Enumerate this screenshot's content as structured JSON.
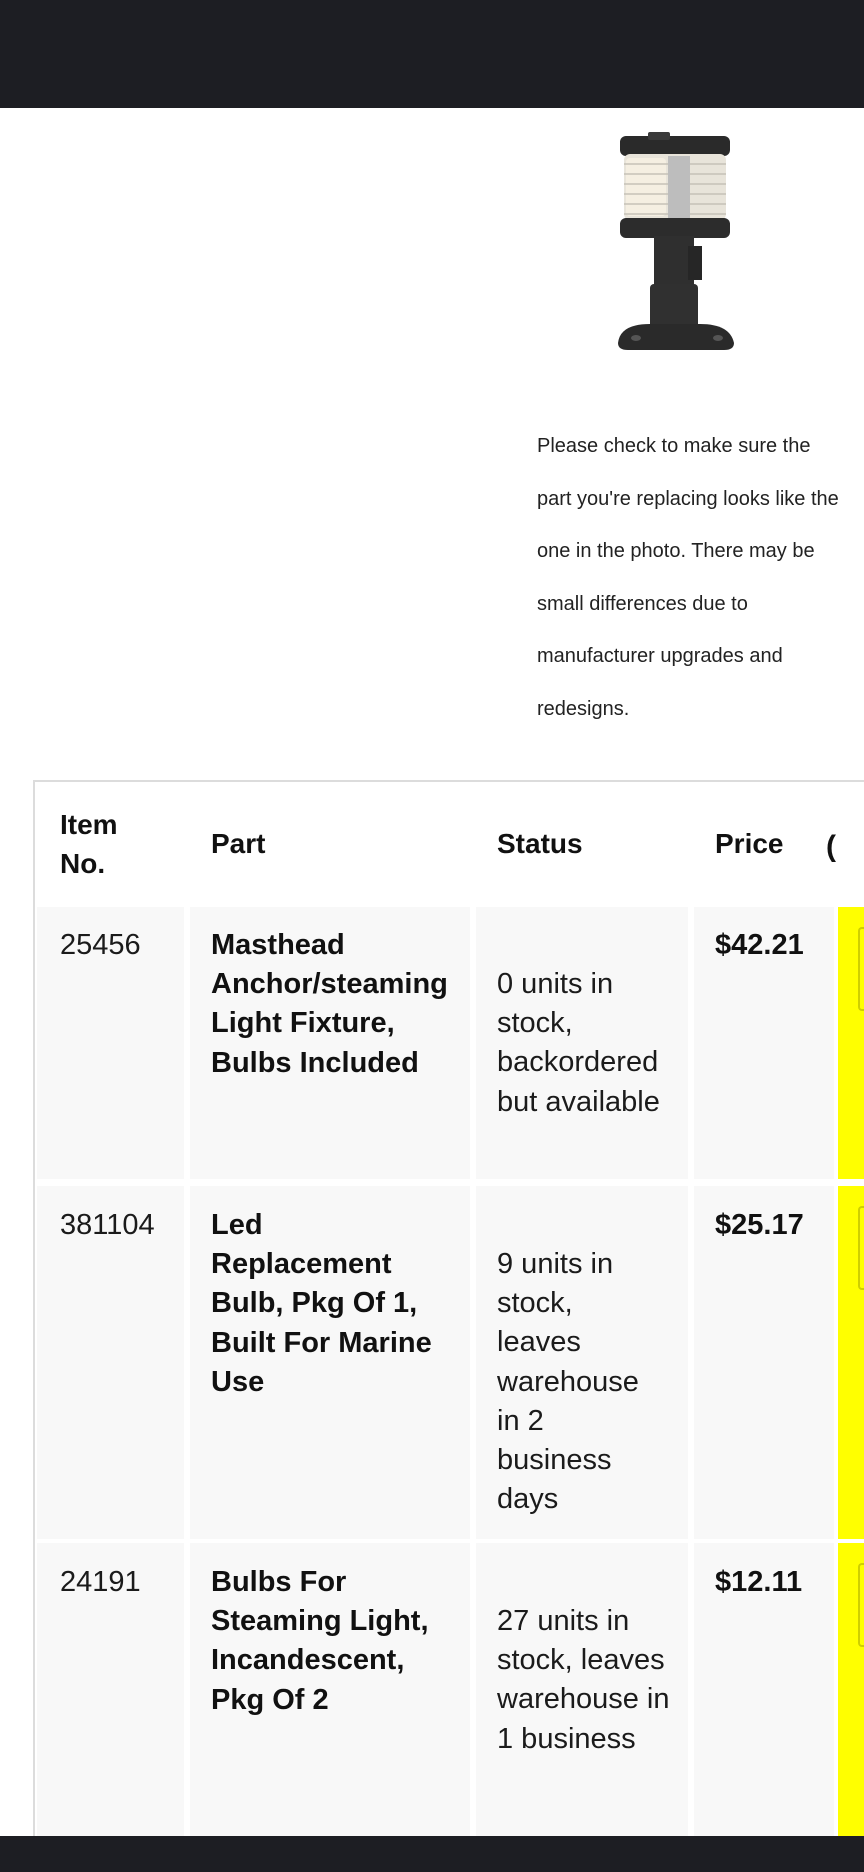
{
  "product": {
    "image_alt": "Masthead anchor/steaming light fixture",
    "note": "Please check to make sure the part you're replacing looks like the one in the photo. There may be small differences due to manufacturer upgrades and redesigns."
  },
  "table": {
    "headers": {
      "item_no": "Item No.",
      "part": "Part",
      "status": "Status",
      "price": "Price"
    },
    "rows": [
      {
        "item_no": "25456",
        "part": "Masthead Anchor/steaming Light Fixture, Bulbs Included",
        "status": "0 units in stock, backordered but available",
        "price": "$42.21"
      },
      {
        "item_no": "381104",
        "part": "Led Replacement Bulb, Pkg Of 1, Built For Marine Use",
        "status": "9 units in stock, leaves warehouse in 2 business days",
        "price": "$25.17"
      },
      {
        "item_no": "24191",
        "part": "Bulbs For Steaming Light, Incandescent, Pkg Of 2",
        "status": "27 units in stock, leaves warehouse in 1 business",
        "price": "$12.11"
      }
    ]
  },
  "colors": {
    "topbar": "#1d1e23",
    "highlight": "#ffff00",
    "cell_bg": "#f8f8f8"
  }
}
